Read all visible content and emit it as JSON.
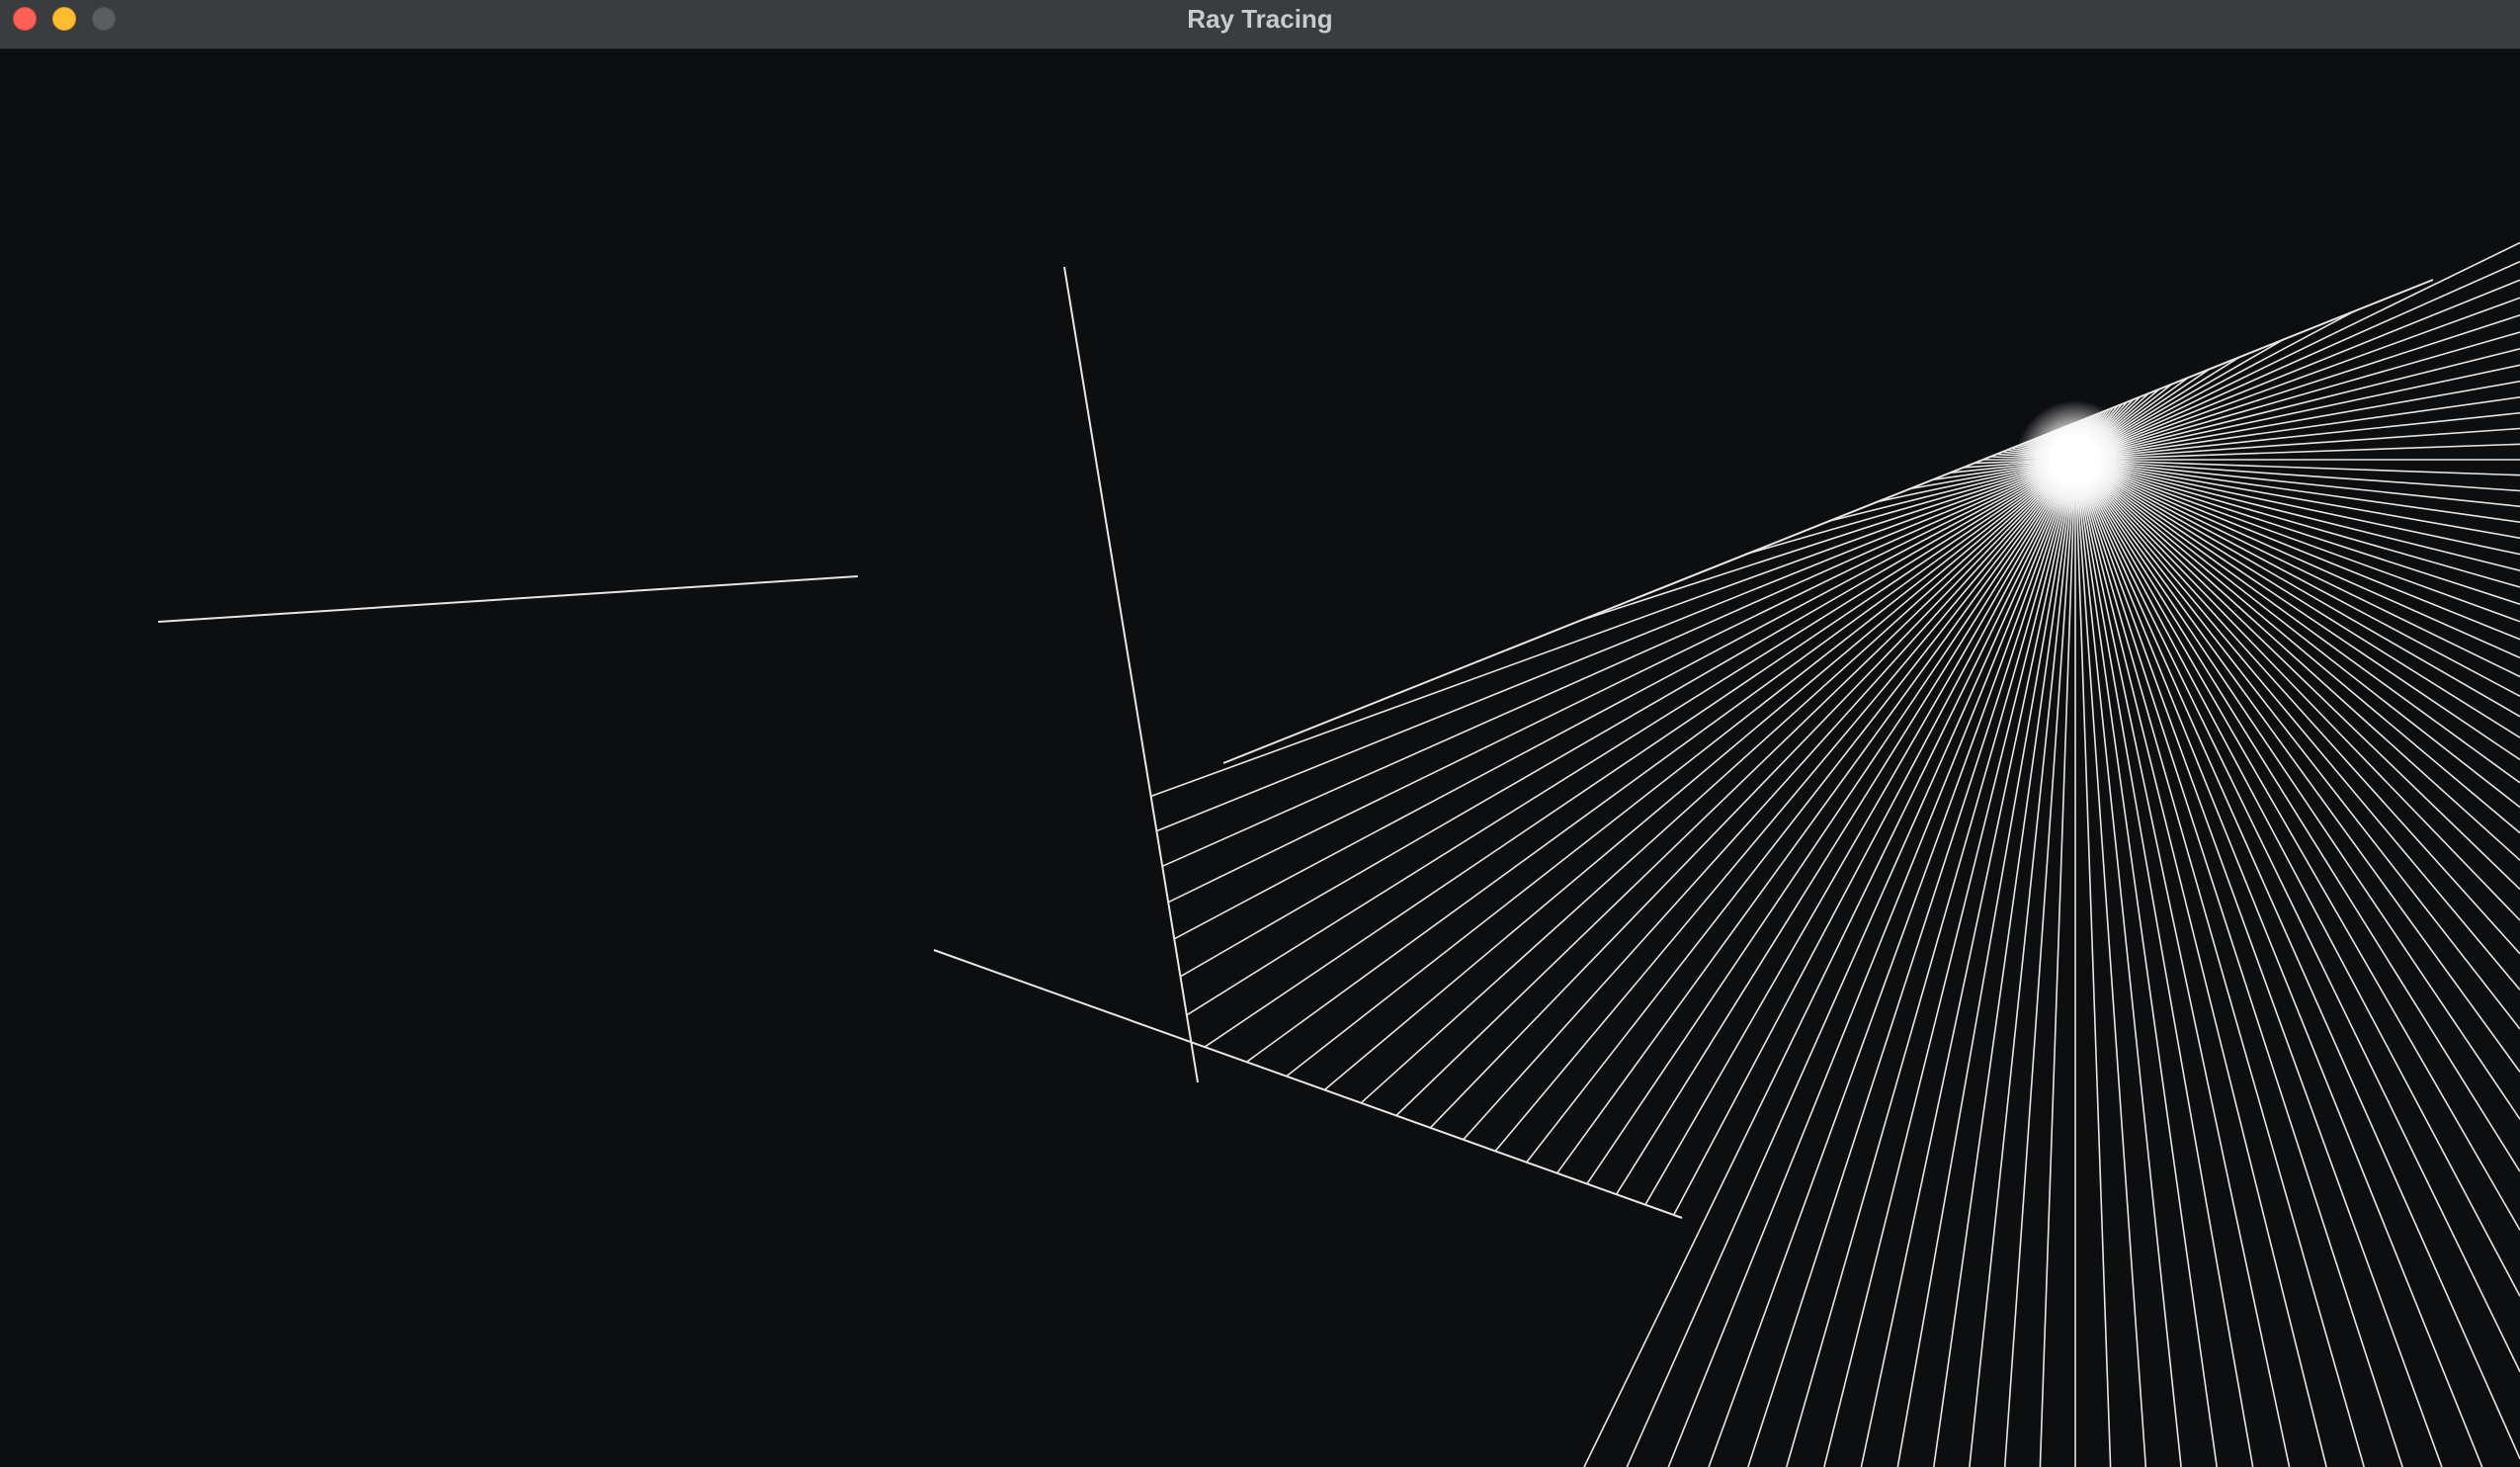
{
  "window": {
    "title": "Ray Tracing",
    "controls": {
      "close": "close-button",
      "minimize": "minimize-button",
      "zoom": "zoom-button"
    }
  },
  "scene": {
    "background_color": "#0d0e10",
    "ray_color": "#e6e6e6",
    "wall_color": "#e6e6e6",
    "light_source_color": "#ffffff"
  }
}
